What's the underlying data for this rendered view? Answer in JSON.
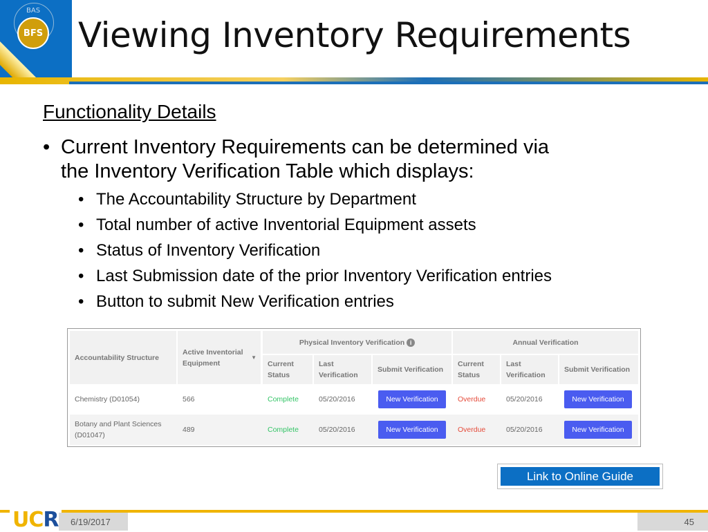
{
  "logo": {
    "bas": "BAS",
    "bfs": "BFS"
  },
  "title": "Viewing Inventory Requirements",
  "subtitle": "Functionality Details",
  "bullet": {
    "line1": "Current Inventory Requirements can be determined via",
    "line2": "the Inventory Verification Table which displays:"
  },
  "sub_bullets": [
    "The Accountability Structure by Department",
    "Total number of active Inventorial Equipment assets",
    "Status of Inventory Verification",
    "Last Submission date of the prior Inventory Verification entries",
    "Button to submit New Verification entries"
  ],
  "table": {
    "headers": {
      "accountability": "Accountability Structure",
      "active": "Active Inventorial Equipment",
      "physical": "Physical Inventory Verification",
      "annual": "Annual Verification",
      "current_status": "Current Status",
      "last_verification": "Last Verification",
      "submit": "Submit Verification"
    },
    "rows": [
      {
        "structure": "Chemistry (D01054)",
        "active": "566",
        "phys_status": "Complete",
        "phys_last": "05/20/2016",
        "phys_button": "New Verification",
        "ann_status": "Overdue",
        "ann_last": "05/20/2016",
        "ann_button": "New Verification"
      },
      {
        "structure": "Botany and Plant Sciences (D01047)",
        "active": "489",
        "phys_status": "Complete",
        "phys_last": "05/20/2016",
        "phys_button": "New Verification",
        "ann_status": "Overdue",
        "ann_last": "05/20/2016",
        "ann_button": "New Verification"
      }
    ]
  },
  "link": "Link to Online Guide",
  "footer": {
    "logo": "UCR",
    "date": "6/19/2017",
    "page": "45"
  },
  "colors": {
    "brand_blue": "#0c6fc4",
    "gold": "#f0b400",
    "complete": "#33c466",
    "overdue": "#e54b3a",
    "button": "#4a5cf0"
  }
}
